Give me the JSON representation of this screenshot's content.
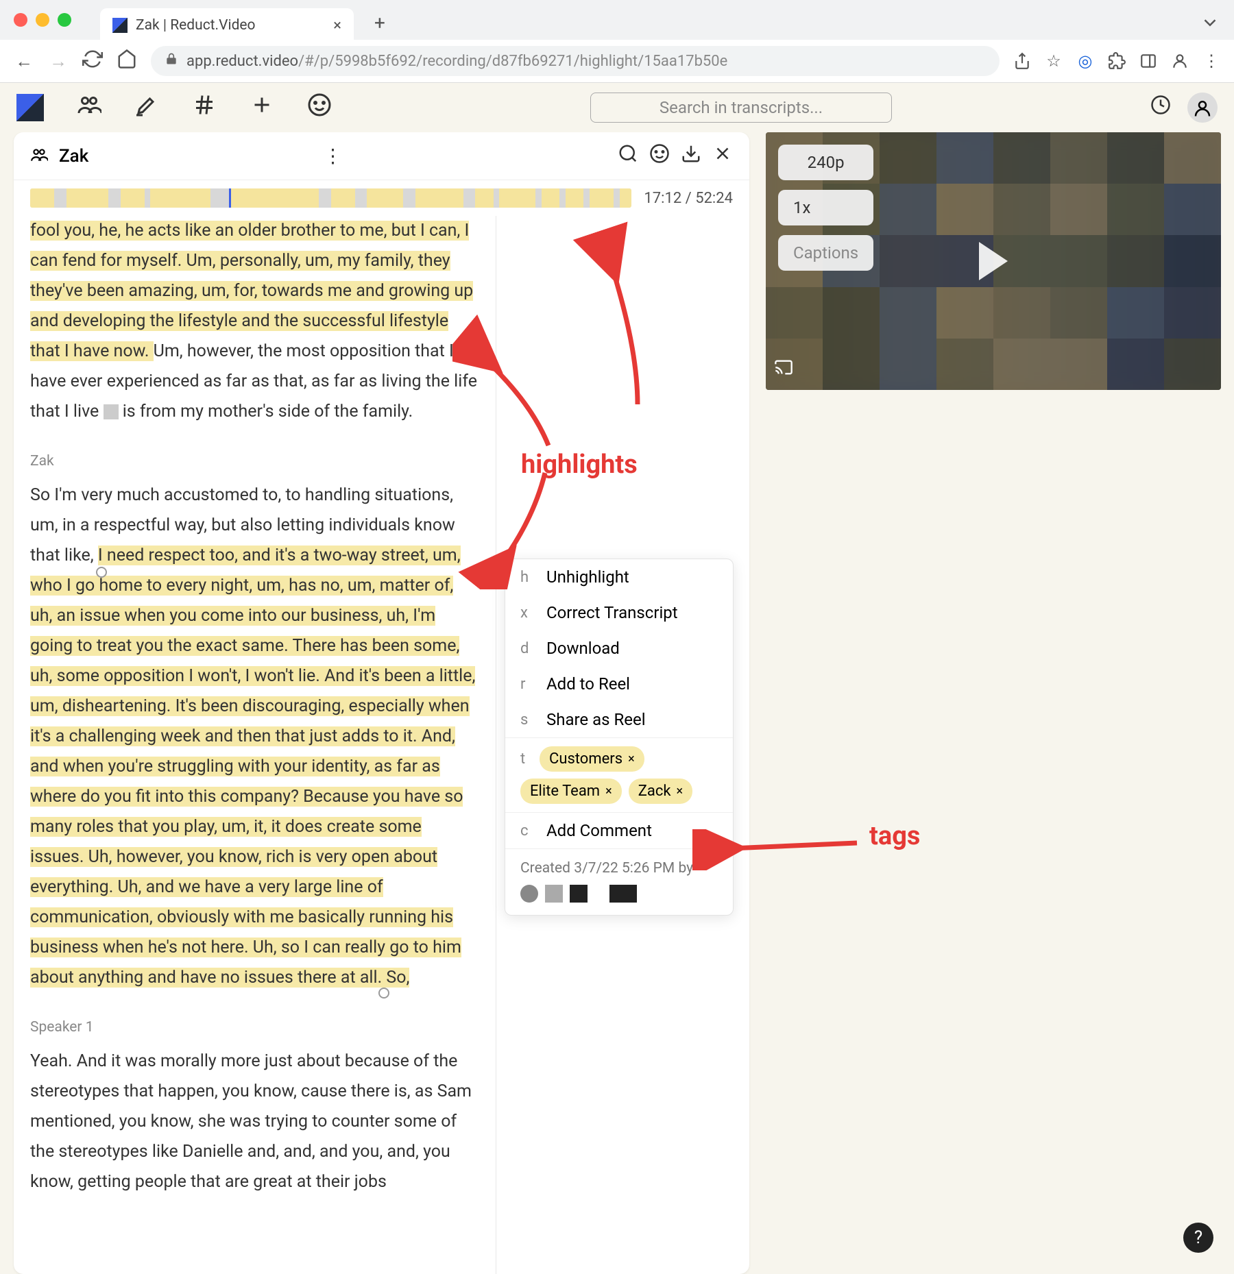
{
  "browser": {
    "tab_title": "Zak | Reduct.Video",
    "url_host": "app.reduct.video",
    "url_path": "/#/p/5998b5f692/recording/d87fb69271/highlight/15aa17b50e"
  },
  "toolbar": {
    "search_placeholder": "Search in transcripts..."
  },
  "panel": {
    "title": "Zak",
    "time_current": "17:12",
    "time_total": "52:24"
  },
  "transcript": {
    "para1_prefix": "fool you, he, he acts like an older brother to me, but I can, I can fend for myself.",
    "para1_hl": " Um, personally, um, my family, they they've been amazing, um, for, towards me and growing up and developing the lifestyle and the successful lifestyle that I have now. ",
    "para1_suffix": "Um, however, the most opposition that I have ever experienced as far as that, as far as living the life that I live ",
    "para1_after_redact": " is from my mother's side of the family.",
    "speaker1": "Zak",
    "para2_prefix": "So I'm very much accustomed to, to handling situations, um, in a respectful way, but also letting individuals know that like, ",
    "para2_hl": "I need respect too, and it's a two-way street, um, who I go home to every night, um, has no, um, matter of, uh, an issue when you come into our business, uh, I'm going to treat you the exact same. There has been some, uh, some opposition I won't, I won't lie. And it's been a little, um, disheartening. It's been discouraging, especially when it's a challenging week and then that just adds to it. And, and when you're struggling with your identity, as far as where do you fit into this company? Because you have so many roles that you play, um, it, it does create some issues. Uh, however, you know, rich is very open about everything. Uh, and we have a very large line of communication, obviously with me basically running his business when he's not here. Uh, so I can really go to him about anything and have no issues there at all. So,",
    "speaker2": "Speaker 1",
    "para3": "Yeah. And it was morally more just about because of the stereotypes that happen, you know, cause there is, as Sam mentioned, you know, she was trying to counter some of the stereotypes like Danielle and, and, and you, and, you know, getting people that are great at their jobs"
  },
  "context_menu": {
    "items": [
      {
        "key": "h",
        "label": "Unhighlight"
      },
      {
        "key": "x",
        "label": "Correct Transcript"
      },
      {
        "key": "d",
        "label": "Download"
      },
      {
        "key": "r",
        "label": "Add to Reel"
      },
      {
        "key": "s",
        "label": "Share as Reel"
      }
    ],
    "tag_key": "t",
    "tags": [
      "Customers",
      "Elite Team",
      "Zack"
    ],
    "comment_key": "c",
    "comment_label": "Add Comment",
    "footer": "Created 3/7/22 5:26 PM by"
  },
  "video": {
    "quality": "240p",
    "speed": "1x",
    "captions_label": "Captions"
  },
  "annotations": {
    "highlights": "highlights",
    "tags": "tags"
  },
  "timeline_segments": [
    {
      "l": 0,
      "w": 4
    },
    {
      "l": 6,
      "w": 7
    },
    {
      "l": 15,
      "w": 4
    },
    {
      "l": 20,
      "w": 10
    },
    {
      "l": 33,
      "w": 15
    },
    {
      "l": 50,
      "w": 4
    },
    {
      "l": 56,
      "w": 6
    },
    {
      "l": 64,
      "w": 8
    },
    {
      "l": 74,
      "w": 3
    },
    {
      "l": 78,
      "w": 6
    },
    {
      "l": 85,
      "w": 3
    },
    {
      "l": 89,
      "w": 3
    },
    {
      "l": 93,
      "w": 4
    },
    {
      "l": 98,
      "w": 2
    }
  ],
  "timeline_cursor": 33
}
